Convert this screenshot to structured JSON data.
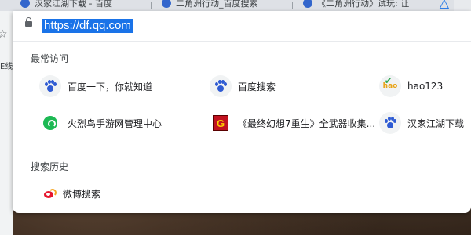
{
  "tabs": [
    {
      "title": "汉家江湖下载 - 百度"
    },
    {
      "title": "二角洲行动_百度搜索"
    },
    {
      "title": "《二角洲行动》试玩: 让"
    }
  ],
  "toolbar": {
    "bookmark_fragment": "E线"
  },
  "omnibox": {
    "url": "https://df.qq.com"
  },
  "most_visited": {
    "title": "最常访问",
    "items": [
      {
        "label": "百度一下，你就知道",
        "icon": "baidu-paw-icon"
      },
      {
        "label": "百度搜索",
        "icon": "baidu-paw-icon"
      },
      {
        "label": "hao123",
        "icon": "hao123-icon"
      },
      {
        "label": "火烈鸟手游网管理中心",
        "icon": "huolieniao-icon"
      },
      {
        "label": "《最终幻想7重生》全武器收集...",
        "icon": "g-logo-icon"
      },
      {
        "label": "汉家江湖下载",
        "icon": "baidu-paw-icon"
      }
    ]
  },
  "history": {
    "title": "搜索历史",
    "items": [
      {
        "label": "微博搜索",
        "icon": "weibo-icon"
      }
    ]
  },
  "colors": {
    "selection": "#1a73e8",
    "baidu_blue": "#2f5bd3"
  }
}
